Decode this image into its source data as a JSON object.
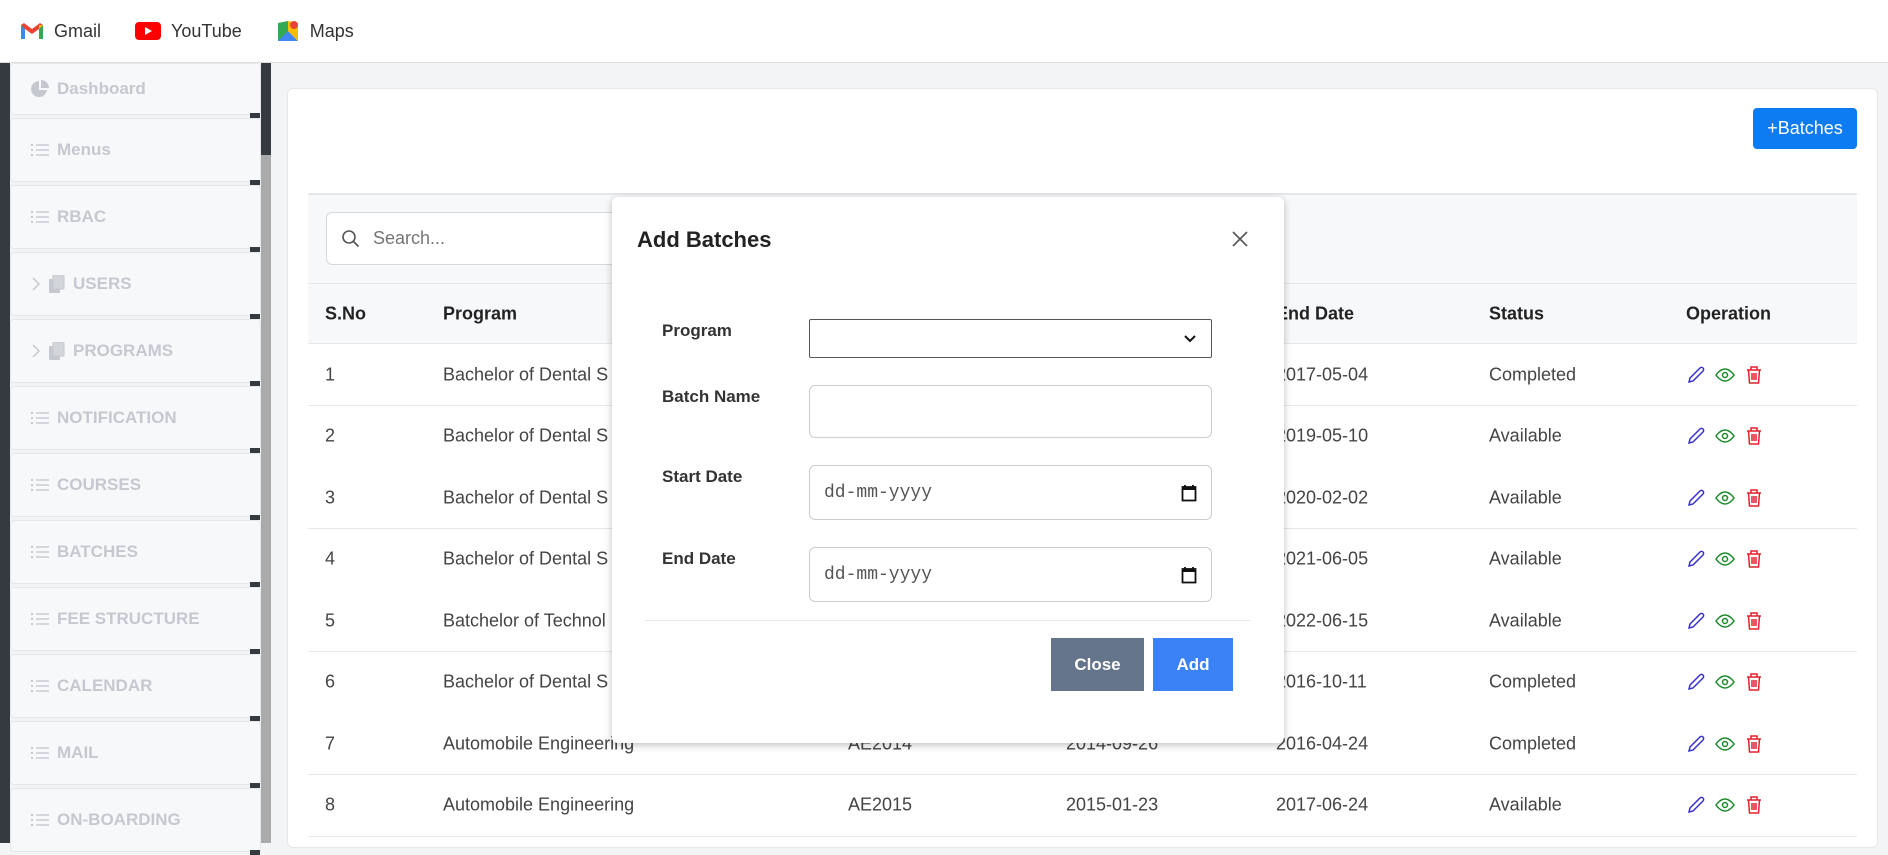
{
  "bookmarks": [
    {
      "label": "Gmail",
      "icon": "gmail-icon"
    },
    {
      "label": "YouTube",
      "icon": "youtube-icon"
    },
    {
      "label": "Maps",
      "icon": "maps-icon"
    }
  ],
  "sidebar": {
    "items": [
      {
        "label": "Dashboard",
        "icon": "pie-chart-icon"
      },
      {
        "label": "Menus",
        "icon": "list-icon"
      },
      {
        "label": "RBAC",
        "icon": "list-icon"
      },
      {
        "label": "USERS",
        "icon": "files-icon",
        "expandable": true
      },
      {
        "label": "PROGRAMS",
        "icon": "files-icon",
        "expandable": true
      },
      {
        "label": "NOTIFICATION",
        "icon": "list-icon"
      },
      {
        "label": "COURSES",
        "icon": "list-icon"
      },
      {
        "label": "BATCHES",
        "icon": "list-icon"
      },
      {
        "label": "FEE STRUCTURE",
        "icon": "list-icon"
      },
      {
        "label": "CALENDAR",
        "icon": "list-icon"
      },
      {
        "label": "MAIL",
        "icon": "list-icon"
      },
      {
        "label": "ON-BOARDING",
        "icon": "list-icon"
      }
    ]
  },
  "main": {
    "add_button": "+Batches",
    "search_placeholder": "Search...",
    "columns": [
      "S.No",
      "Program",
      "",
      "",
      "End Date",
      "Status",
      "Operation"
    ],
    "rows": [
      [
        "1",
        "Bachelor of Dental S",
        "",
        "",
        "2017-05-04",
        "Completed"
      ],
      [
        "2",
        "Bachelor of Dental S",
        "",
        "",
        "2019-05-10",
        "Available"
      ],
      [
        "3",
        "Bachelor of Dental S",
        "",
        "",
        "2020-02-02",
        "Available"
      ],
      [
        "4",
        "Bachelor of Dental S",
        "",
        "",
        "2021-06-05",
        "Available"
      ],
      [
        "5",
        "Batchelor of Technol",
        "",
        "",
        "2022-06-15",
        "Available"
      ],
      [
        "6",
        "Bachelor of Dental S",
        "",
        "",
        "2016-10-11",
        "Completed"
      ],
      [
        "7",
        "Automobile Engineering",
        "AE2014",
        "2014-09-26",
        "2016-04-24",
        "Completed"
      ],
      [
        "8",
        "Automobile Engineering",
        "AE2015",
        "2015-01-23",
        "2017-06-24",
        "Available"
      ]
    ]
  },
  "modal": {
    "title": "Add Batches",
    "fields": [
      {
        "label": "Program",
        "type": "select",
        "value": ""
      },
      {
        "label": "Batch Name",
        "type": "text",
        "value": ""
      },
      {
        "label": "Start Date",
        "type": "date",
        "placeholder": "dd-mm-yyyy"
      },
      {
        "label": "End Date",
        "type": "date",
        "placeholder": "dd-mm-yyyy"
      }
    ],
    "close_label": "Close",
    "add_label": "Add"
  },
  "colors": {
    "primary": "#0d7cf2",
    "add": "#3b82f6",
    "close": "#64748b",
    "edit": "#3730c8",
    "view": "#1a8a2a",
    "delete": "#e5202a"
  }
}
